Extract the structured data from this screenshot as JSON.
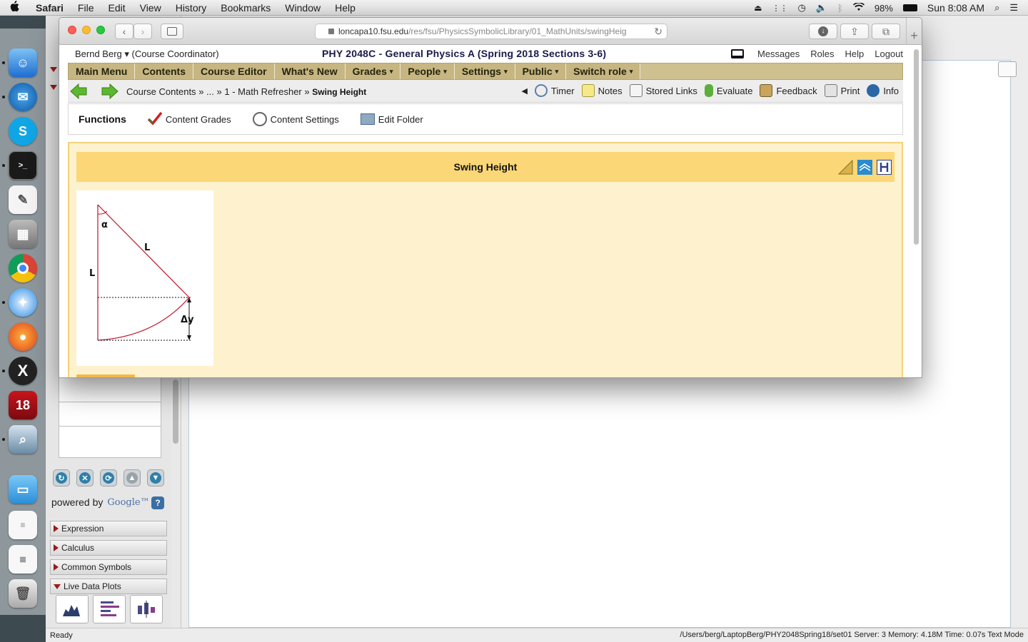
{
  "menubar": {
    "apple": "",
    "app": "Safari",
    "items": [
      "File",
      "Edit",
      "View",
      "History",
      "Bookmarks",
      "Window",
      "Help"
    ],
    "battery": "98%",
    "clock": "Sun 8:08 AM"
  },
  "safari": {
    "url_main": "loncapa10.fsu.edu",
    "url_path": "/res/fsu/PhysicsSymbolicLibrary/01_MathUnits/swingHeig",
    "plus": "+"
  },
  "loncapa": {
    "user": "Bernd Berg ▾  (Course Coordinator)",
    "course": "PHY 2048C - General Physics A (Spring 2018 Sections 3-6)",
    "top_links": [
      "Messages",
      "Roles",
      "Help",
      "Logout"
    ],
    "nav": [
      {
        "label": "Main Menu",
        "dropdown": false
      },
      {
        "label": "Contents",
        "dropdown": false
      },
      {
        "label": "Course Editor",
        "dropdown": false
      },
      {
        "label": "What's New",
        "dropdown": false
      },
      {
        "label": "Grades",
        "dropdown": true
      },
      {
        "label": "People",
        "dropdown": true
      },
      {
        "label": "Settings",
        "dropdown": true
      },
      {
        "label": "Public",
        "dropdown": true
      },
      {
        "label": "Switch role",
        "dropdown": true
      }
    ],
    "dropdown_arrow": "▾",
    "breadcrumb": {
      "parts": [
        "Course Contents",
        "»",
        "...",
        "»",
        "1 - Math Refresher",
        "»"
      ],
      "current": "Swing Height"
    },
    "tools": [
      "Timer",
      "Notes",
      "Stored Links",
      "Evaluate",
      "Feedback",
      "Print",
      "Info"
    ],
    "collapse_arrow": "◀",
    "functions": {
      "title": "Functions",
      "items": [
        "Content Grades",
        "Content Settings",
        "Edit Folder"
      ]
    },
    "resource_title": "Swing Height",
    "figure": {
      "alpha": "α",
      "L_side": "L",
      "L_hyp": "L",
      "delta_y": "Δy"
    }
  },
  "background_app": {
    "powered_by": "powered by",
    "google": "Google™",
    "help": "?",
    "sections": [
      {
        "label": "Expression",
        "open": false
      },
      {
        "label": "Calculus",
        "open": false
      },
      {
        "label": "Common Symbols",
        "open": false
      },
      {
        "label": "Live Data Plots",
        "open": true
      }
    ]
  },
  "statusbar": {
    "left": "Ready",
    "right": "/Users/berg/LaptopBerg/PHY2048Spring18/set01   Server: 3   Memory: 4.18M   Time: 0.07s   Text Mode"
  },
  "dock": {
    "skype": "S",
    "calendar_day": "18"
  }
}
